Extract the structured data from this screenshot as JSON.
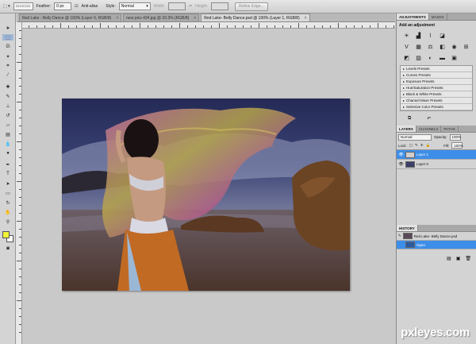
{
  "options_bar": {
    "feather_label": "Feather:",
    "feather_value": "0 px",
    "antialias_label": "Anti-alias",
    "style_label": "Style:",
    "style_value": "Normal",
    "width_label": "Width:",
    "height_label": "Height:",
    "refine_edge_label": "Refine Edge..."
  },
  "tabs": [
    {
      "label": "Red Lake - Belly Dance @ 100% (Layer 0, RGB/8)"
    },
    {
      "label": "new pics 434.jpg @ 33.3% (RGB/8)"
    },
    {
      "label": "Red Lake- Belly Dance.psd @ 100% (Layer 1, RGB/8)"
    }
  ],
  "adjustments": {
    "tab_active": "ADJUSTMENTS",
    "tab_other": "MASKS",
    "title": "Add an adjustment",
    "presets": [
      "Levels Presets",
      "Curves Presets",
      "Exposure Presets",
      "Hue/Saturation Presets",
      "Black & White Presets",
      "Channel Mixer Presets",
      "Selective Color Presets"
    ]
  },
  "layers": {
    "tab_active": "LAYERS",
    "tab_channels": "CHANNELS",
    "tab_paths": "PATHS",
    "blend_mode": "Normal",
    "opacity_label": "Opacity:",
    "opacity_value": "100%",
    "lock_label": "Lock:",
    "fill_label": "Fill:",
    "fill_value": "100%",
    "items": [
      {
        "name": "Layer 1",
        "selected": true
      },
      {
        "name": "Layer 0",
        "selected": false
      }
    ]
  },
  "history": {
    "tab": "HISTORY",
    "snapshot": "Red Lake- Belly Dance.psd",
    "items": [
      {
        "name": "Open",
        "selected": true
      }
    ]
  },
  "watermark": "pxleyes.com",
  "colors": {
    "foreground": "#f2f23a",
    "background": "#ffffff",
    "selection": "#3d8ee8"
  }
}
